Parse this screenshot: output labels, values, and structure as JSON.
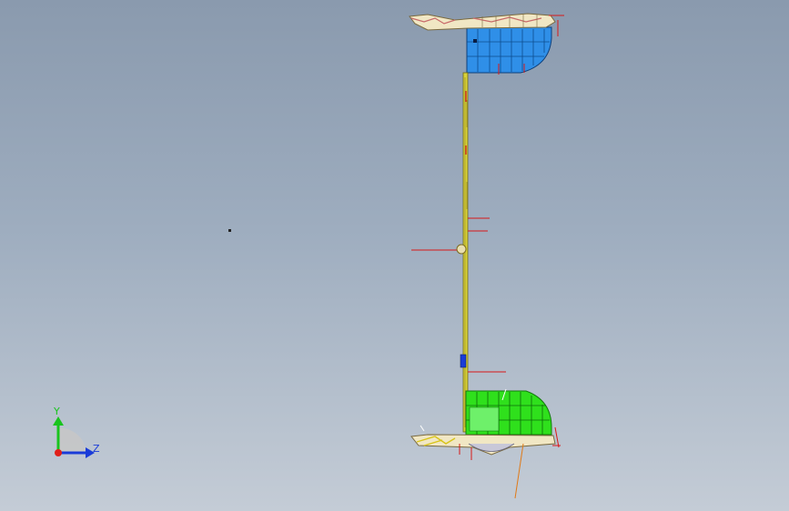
{
  "viewport": {
    "background_top": "#8a9aae",
    "background_bottom": "#c4ccd6"
  },
  "triad": {
    "y_label": "Y",
    "z_label": "Z",
    "y_color": "#19c41e",
    "z_color": "#1a3cd8",
    "origin_color": "#e0201a"
  },
  "model": {
    "upper_drum_color": "#2f8fe8",
    "lower_drum_color": "#2fe01c",
    "frame_color": "#e8dfb0",
    "rod_color": "#d8d23a",
    "dimension_line_color": "#d81818",
    "leader_line_color": "#e07a18"
  }
}
